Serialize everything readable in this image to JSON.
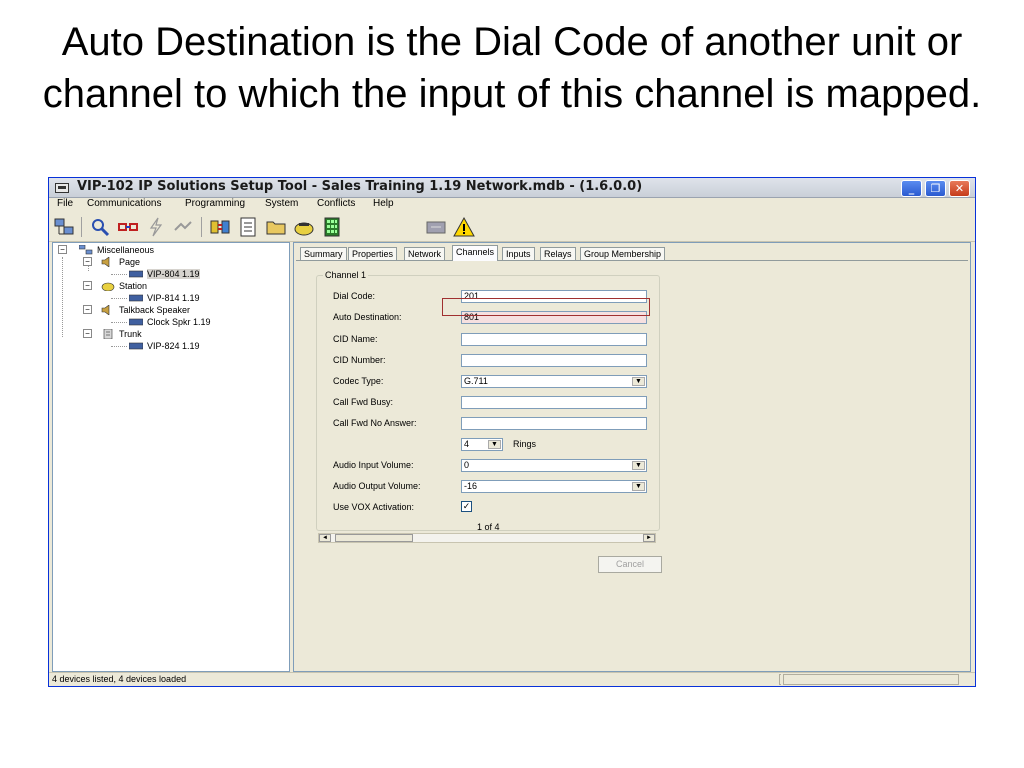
{
  "slide": {
    "title": "Auto Destination is the Dial Code of another unit or channel to which the input of this channel is mapped."
  },
  "window": {
    "title": "VIP-102 IP Solutions Setup Tool - Sales Training 1.19 Network.mdb - (1.6.0.0)",
    "minimize_label": "_",
    "restore_label": "❐",
    "close_label": "✕"
  },
  "menu": {
    "items": [
      "File",
      "Communications",
      "Programming",
      "System",
      "Conflicts",
      "Help"
    ]
  },
  "tree": {
    "root": "Miscellaneous",
    "page": "Page",
    "page_child": "VIP-804 1.19",
    "station": "Station",
    "station_child": "VIP-814 1.19",
    "talkback": "Talkback Speaker",
    "talkback_child": "Clock Spkr 1.19",
    "trunk": "Trunk",
    "trunk_child": "VIP-824 1.19"
  },
  "tabs": [
    "Summary",
    "Properties",
    "Network",
    "Channels",
    "Inputs",
    "Relays",
    "Group Membership"
  ],
  "channel": {
    "group_title": "Channel 1",
    "dial_code_label": "Dial Code:",
    "dial_code": "201",
    "auto_destination_label": "Auto Destination:",
    "auto_destination": "801",
    "cid_name_label": "CID Name:",
    "cid_name": "",
    "cid_number_label": "CID Number:",
    "cid_number": "",
    "codec_type_label": "Codec Type:",
    "codec_type": "G.711",
    "call_fwd_busy_label": "Call Fwd Busy:",
    "call_fwd_busy": "",
    "call_fwd_no_answer_label": "Call Fwd No Answer:",
    "call_fwd_no_answer": "",
    "rings_value": "4",
    "rings_label": "Rings",
    "audio_input_volume_label": "Audio Input Volume:",
    "audio_input_volume": "0",
    "audio_output_volume_label": "Audio Output Volume:",
    "audio_output_volume": "-16",
    "use_vox_label": "Use VOX Activation:",
    "use_vox_check": "✓",
    "pager": "1 of 4",
    "cancel_label": "Cancel"
  },
  "status": {
    "text": "4 devices listed, 4 devices loaded"
  },
  "colors": {
    "highlight_box": "#a03030",
    "title_bar_close": "#c53c1a",
    "window_face": "#ece9d8"
  }
}
